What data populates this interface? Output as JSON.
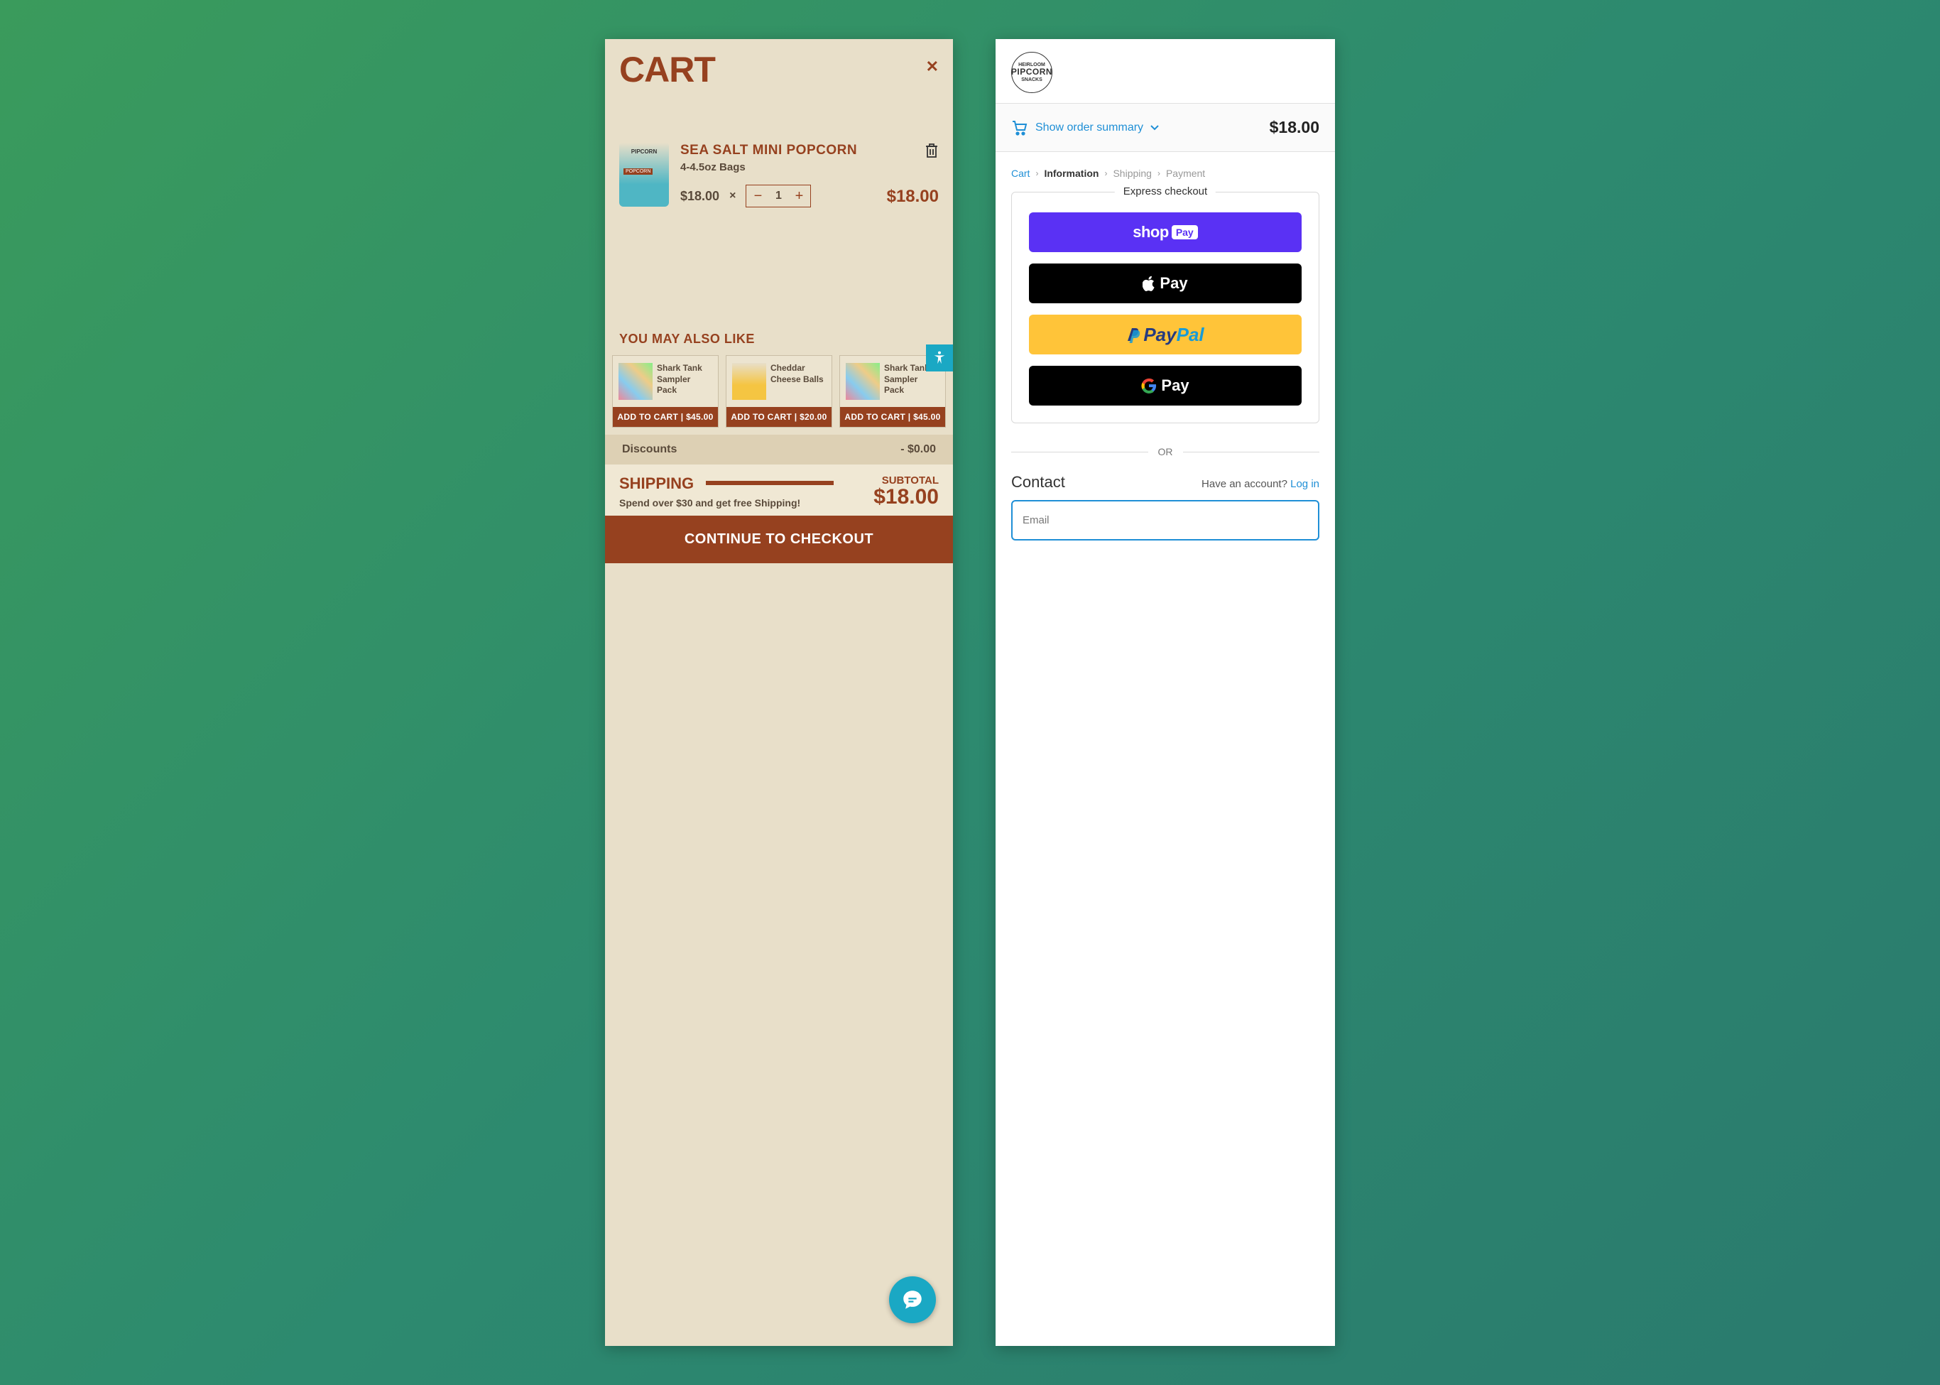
{
  "cart": {
    "title": "CART",
    "item": {
      "name": "SEA SALT MINI POPCORN",
      "size": "4-4.5oz Bags",
      "unit_price": "$18.00",
      "qty": "1",
      "line_total": "$18.00"
    },
    "ymal_title": "YOU MAY ALSO LIKE",
    "recs": [
      {
        "name": "Shark Tank Sampler Pack",
        "btn": "ADD TO CART | $45.00"
      },
      {
        "name": "Cheddar Cheese Balls",
        "btn": "ADD TO CART | $20.00"
      },
      {
        "name": "Shark Tank Sampler Pack",
        "btn": "ADD TO CART | $45.00"
      }
    ],
    "discounts_label": "Discounts",
    "discounts_value": "- $0.00",
    "shipping_title": "SHIPPING",
    "shipping_msg": "Spend over $30 and get free Shipping!",
    "subtotal_label": "SUBTOTAL",
    "subtotal_value": "$18.00",
    "checkout_btn": "CONTINUE TO CHECKOUT"
  },
  "checkout": {
    "brand": "PIPCORN",
    "brand_top": "HEIRLOOM",
    "brand_bottom": "SNACKS",
    "summary_link": "Show order summary",
    "summary_total": "$18.00",
    "breadcrumb": {
      "cart": "Cart",
      "info": "Information",
      "ship": "Shipping",
      "pay": "Payment"
    },
    "express_label": "Express checkout",
    "or_label": "OR",
    "contact_title": "Contact",
    "login_prompt": "Have an account?",
    "login_link": "Log in",
    "email_placeholder": "Email"
  }
}
